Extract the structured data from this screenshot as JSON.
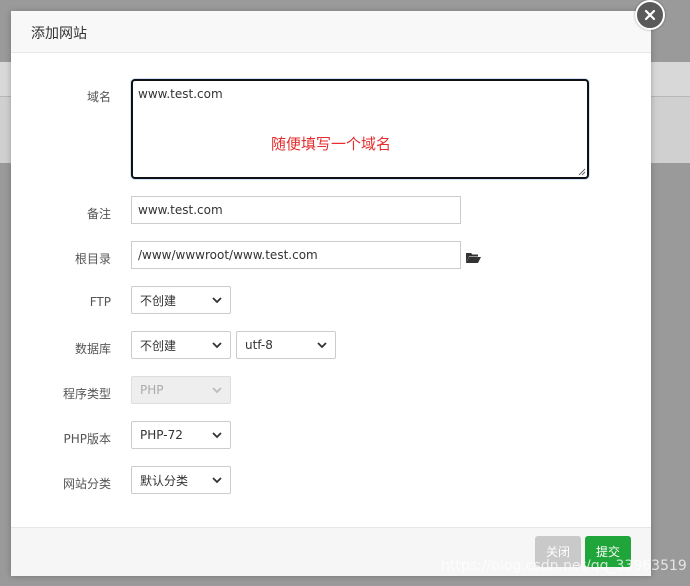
{
  "modal": {
    "title": "添加网站"
  },
  "form": {
    "domain": {
      "label": "域名",
      "value": "www.test.com",
      "hint": "随便填写一个域名"
    },
    "remark": {
      "label": "备注",
      "value": "www.test.com"
    },
    "root_dir": {
      "label": "根目录",
      "value": "/www/wwwroot/www.test.com"
    },
    "ftp": {
      "label": "FTP",
      "selected": "不创建"
    },
    "database": {
      "label": "数据库",
      "selected": "不创建",
      "charset": "utf-8"
    },
    "program_type": {
      "label": "程序类型",
      "selected": "PHP"
    },
    "php_version": {
      "label": "PHP版本",
      "selected": "PHP-72"
    },
    "site_category": {
      "label": "网站分类",
      "selected": "默认分类"
    }
  },
  "footer": {
    "close_label": "关闭",
    "submit_label": "提交"
  },
  "watermark": "https://blog.csdn.net/qq_33963519",
  "colors": {
    "accent": "#20a53a",
    "hint": "#e52e2e"
  },
  "icons": {
    "close": "close-icon",
    "folder": "folder-open-icon",
    "dropdown": "chevron-down-icon"
  }
}
